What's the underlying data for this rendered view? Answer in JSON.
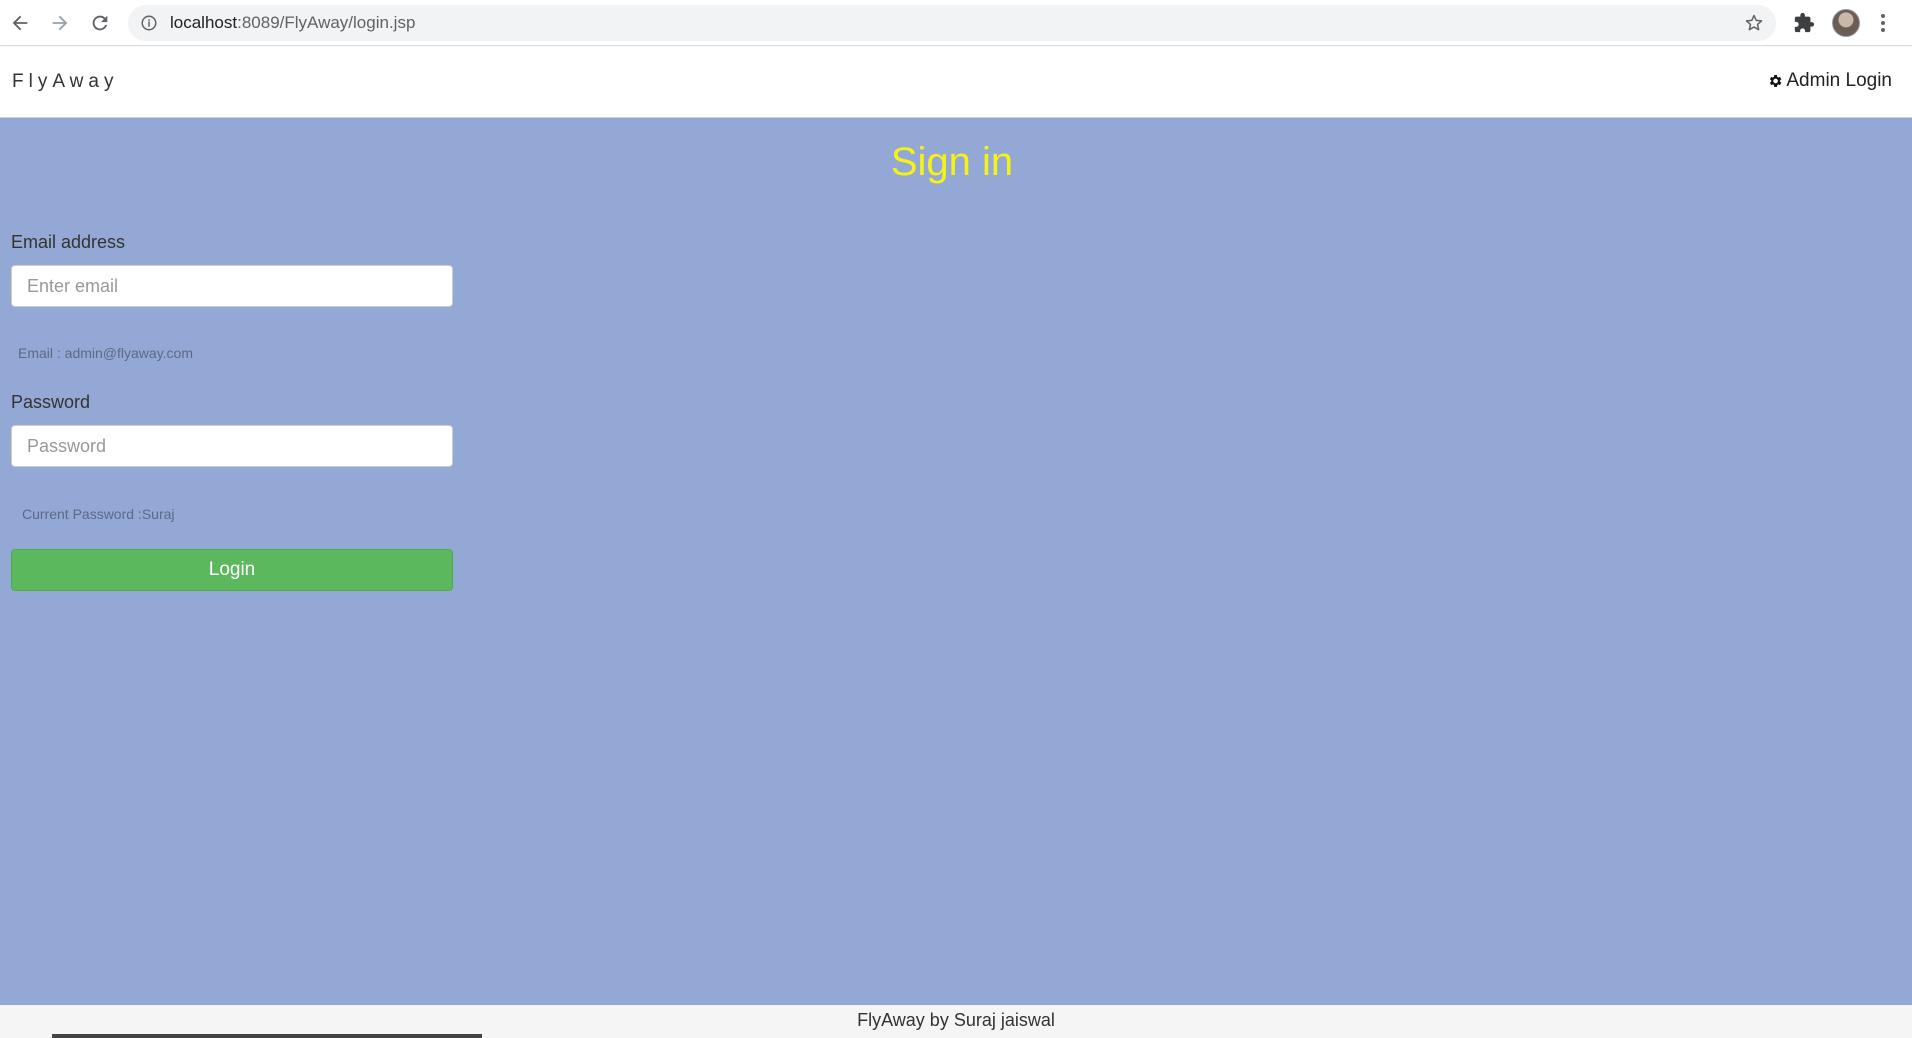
{
  "browser": {
    "url_host": "localhost",
    "url_rest": ":8089/FlyAway/login.jsp"
  },
  "navbar": {
    "brand": "FlyAway",
    "admin_login": "Admin Login"
  },
  "main": {
    "title": "Sign in",
    "email": {
      "label": "Email address",
      "placeholder": "Enter email",
      "hint": "Email : admin@flyaway.com"
    },
    "password": {
      "label": "Password",
      "placeholder": "Password",
      "hint": "Current Password :Suraj"
    },
    "login_button": "Login"
  },
  "footer": {
    "text": "FlyAway by Suraj jaiswal"
  },
  "colors": {
    "background": "#93a8d4",
    "title": "#f4f219",
    "button": "#5cb85c"
  }
}
